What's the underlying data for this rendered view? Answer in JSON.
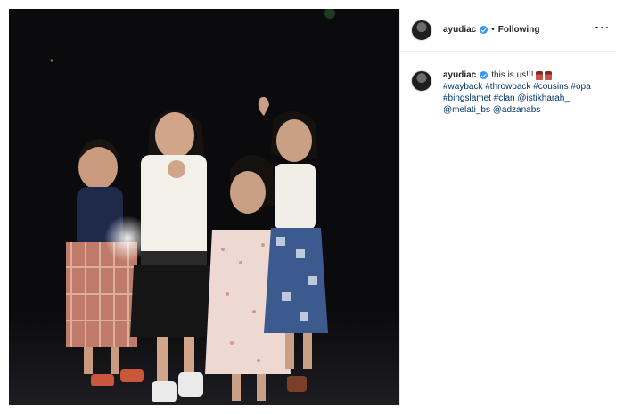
{
  "post": {
    "author": "ayudiac",
    "verified": true,
    "separator": "•",
    "follow_state": "Following",
    "more_icon": "ellipsis-icon"
  },
  "caption": {
    "author": "ayudiac",
    "text": "this is us!!!",
    "emoji": [
      "family-emoji",
      "family-emoji"
    ],
    "tags": [
      "#wayback",
      "#throwback",
      "#cousins",
      "#opa",
      "#bingslamet",
      "#clan",
      "@istikharah_",
      "@melati_bs",
      "@adzanabs"
    ]
  },
  "photo": {
    "subject": "vintage photo of four girls standing together at night",
    "colors": {
      "background": "#0b0b0d",
      "verified": "#3897f0",
      "link": "#003569"
    }
  }
}
